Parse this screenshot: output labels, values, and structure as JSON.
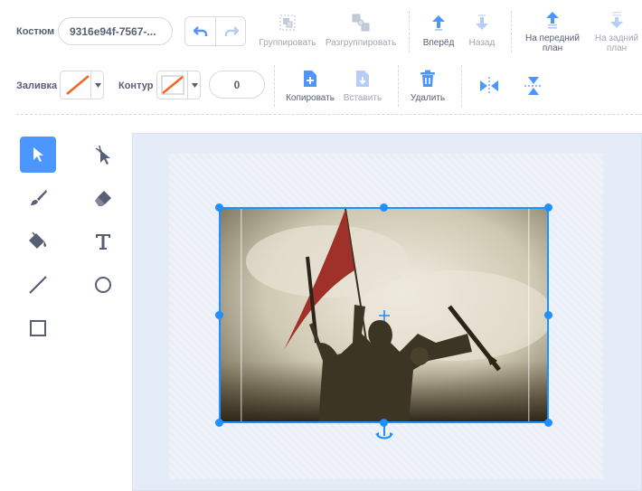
{
  "toolbar": {
    "costume_label": "Костюм",
    "costume_name": "9316e94f-7567-...",
    "group": "Группировать",
    "ungroup": "Разгруппировать",
    "forward": "Вперёд",
    "backward": "Назад",
    "front_line1": "На передний",
    "front_line2": "план",
    "back_line1": "На задний",
    "back_line2": "план"
  },
  "row2": {
    "fill_label": "Заливка",
    "outline_label": "Контур",
    "outline_width": "0",
    "copy": "Копировать",
    "paste": "Вставить",
    "delete": "Удалить"
  },
  "tools": {
    "selected": "select",
    "items": [
      "select",
      "reshape",
      "brush",
      "eraser",
      "fill",
      "text",
      "line",
      "circle",
      "rectangle"
    ]
  },
  "colors": {
    "accent": "#4c97ff",
    "selection": "#1e90ff",
    "canvas_bg": "#e5ecf7",
    "fill_swatch_slash": "#f26522"
  },
  "canvas": {
    "image_description_icon": "soldiers-with-flag-photo"
  }
}
